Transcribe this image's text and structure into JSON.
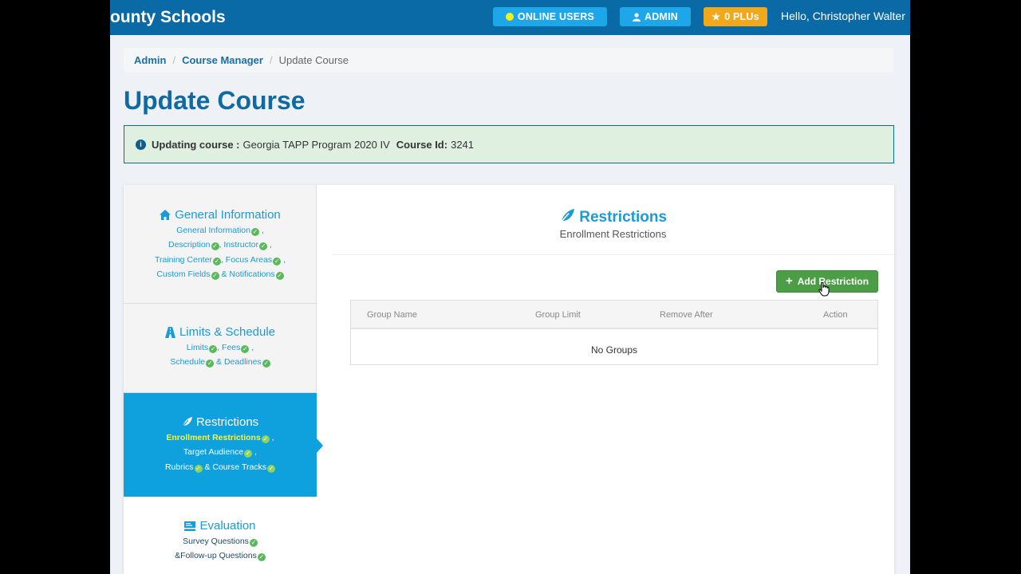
{
  "header": {
    "brand": "ounty Schools",
    "online_users": "ONLINE USERS",
    "admin": "ADMIN",
    "plus": "0 PLUs",
    "greeting_prefix": "Hello,",
    "user_name": "Christopher Walter"
  },
  "breadcrumb": [
    "Admin",
    "Course Manager",
    "Update Course"
  ],
  "page_title": "Update Course",
  "info": {
    "label": "Updating course :",
    "course_name": "Georgia TAPP Program 2020 IV",
    "id_label": "Course Id:",
    "id_value": "3241"
  },
  "sidebar": {
    "general": {
      "title": "General Information",
      "links": [
        "General Information",
        "Description",
        "Instructor",
        "Training Center",
        "Focus Areas",
        "Custom Fields",
        "& Notifications"
      ]
    },
    "limits": {
      "title": "Limits & Schedule",
      "links": [
        "Limits",
        "Fees",
        "Schedule",
        "& Deadlines"
      ]
    },
    "restrictions": {
      "title": "Restrictions",
      "links": [
        "Enrollment Restrictions",
        "Target Audience",
        "Rubrics",
        "& Course Tracks"
      ]
    },
    "evaluation": {
      "title": "Evaluation",
      "links": [
        "Survey Questions",
        "&Follow-up Questions"
      ]
    }
  },
  "main": {
    "title": "Restrictions",
    "subtitle": "Enrollment Restrictions",
    "add_button": "Add Restriction",
    "columns": [
      "Group Name",
      "Group Limit",
      "Remove After",
      "Action"
    ],
    "empty_text": "No Groups"
  }
}
